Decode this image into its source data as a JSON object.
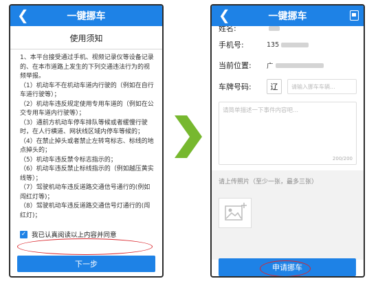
{
  "colors": {
    "primary": "#1e82e6",
    "highlight": "#d9262c",
    "arrow": "#77b82f"
  },
  "screen1": {
    "header_title": "一键挪车",
    "notice_title": "使用须知",
    "terms": [
      "1、本平台接受通过手机、视频记录仪等设备记录的、在本市道路上发生的下列交通违法行为的视频举报。",
      "（1）机动车不在机动车道内行驶的（例如在自行车道行驶等）；",
      "（2）机动车违反规定使用专用车道的（例如在公交专用车道内行驶等）；",
      "（3）通前方机动车停车排队等候或者缓慢行驶时，在人行横道、网状线区域内停车等候的；",
      "（4）在禁止掉头或者禁止左转弯标志、标线的地点掉头的；",
      "（5）机动车违反禁令标志指示的；",
      "（6）机动车违反禁止标线指示的（例如越压黄实线等）；",
      "（7）驾驶机动车违反道路交通信号通行的(例如闯红灯等)；",
      "（8）驾驶机动车违反道路交通信号灯通行的(闯红灯)；"
    ],
    "agree_label": "我已认真阅读以上内容并同意",
    "next_button": "下一步"
  },
  "screen2": {
    "header_title": "一键挪车",
    "name_label": "姓名:",
    "phone_label": "手机号:",
    "phone_value": "135",
    "location_label": "当前位置:",
    "location_value": "广",
    "plate_label": "车牌号码:",
    "plate_prefix": "辽",
    "plate_placeholder": "请输入挪车车辆...",
    "desc_placeholder": "请简单描述一下事件内容吧...",
    "desc_count": "200/200",
    "upload_label": "请上传照片（至少一张，最多三张）",
    "apply_button": "申请挪车"
  }
}
